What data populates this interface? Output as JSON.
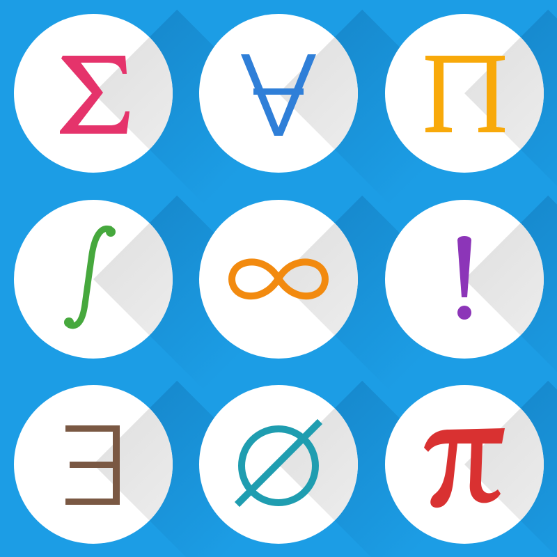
{
  "background_color": "#1c9de5",
  "symbols": [
    {
      "name": "sigma-icon",
      "char": "Σ",
      "color": "#e5336b"
    },
    {
      "name": "for-all-icon",
      "char": "∀",
      "color": "#2f7fd8"
    },
    {
      "name": "pi-capital-icon",
      "char": "Π",
      "color": "#f8a90a"
    },
    {
      "name": "integral-icon",
      "char": "∫",
      "color": "#46a83d"
    },
    {
      "name": "infinity-icon",
      "char": "∞",
      "color": "#f28a0f"
    },
    {
      "name": "exclamation-icon",
      "char": "!",
      "color": "#8c35b8"
    },
    {
      "name": "exists-icon",
      "char": "∃",
      "color": "#7a5843"
    },
    {
      "name": "empty-set-icon",
      "char": "∅",
      "color": "#1f9db0"
    },
    {
      "name": "pi-lower-icon",
      "char": "π",
      "color": "#d93131"
    }
  ]
}
